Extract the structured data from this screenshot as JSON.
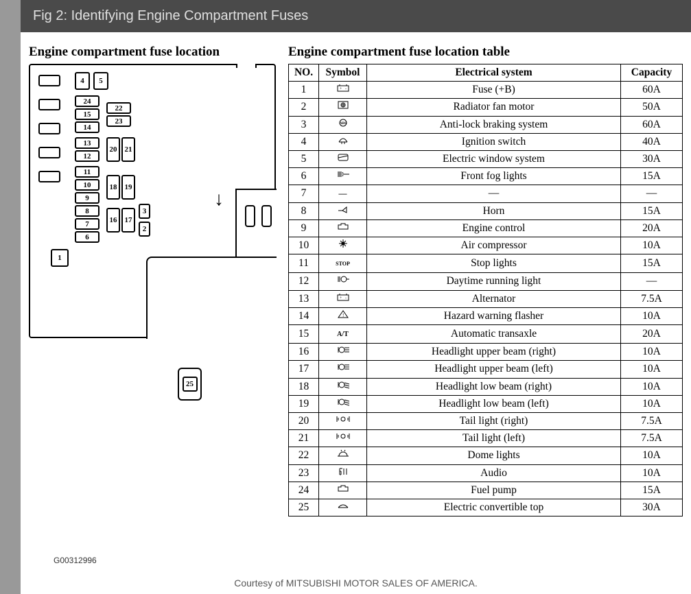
{
  "title": "Fig 2: Identifying Engine Compartment Fuses",
  "left_heading": "Engine compartment fuse location",
  "right_heading": "Engine compartment fuse location table",
  "code": "G00312996",
  "courtesy": "Courtesy of MITSUBISHI MOTOR SALES OF AMERICA.",
  "extra_label": "25",
  "diagram_labels": {
    "b4": "4",
    "b5": "5",
    "b24": "24",
    "b22": "22",
    "b23": "23",
    "b15": "15",
    "b14": "14",
    "b13": "13",
    "b12": "12",
    "b11": "11",
    "b20": "20",
    "b21": "21",
    "b10": "10",
    "b9": "9",
    "b8": "8",
    "b7": "7",
    "b6": "6",
    "b18": "18",
    "b19": "19",
    "b16": "16",
    "b17": "17",
    "b3": "3",
    "b2": "2",
    "b1": "1"
  },
  "table": {
    "headers": {
      "no": "NO.",
      "symbol": "Symbol",
      "system": "Electrical system",
      "capacity": "Capacity"
    },
    "rows": [
      {
        "no": "1",
        "sym": "bat",
        "system": "Fuse (+B)",
        "cap": "60A"
      },
      {
        "no": "2",
        "sym": "fan",
        "system": "Radiator fan motor",
        "cap": "50A"
      },
      {
        "no": "3",
        "sym": "abs",
        "system": "Anti-lock braking system",
        "cap": "60A"
      },
      {
        "no": "4",
        "sym": "ign",
        "system": "Ignition switch",
        "cap": "40A"
      },
      {
        "no": "5",
        "sym": "win",
        "system": "Electric window system",
        "cap": "30A"
      },
      {
        "no": "6",
        "sym": "fog",
        "system": "Front fog lights",
        "cap": "15A"
      },
      {
        "no": "7",
        "sym": "dash",
        "system": "—",
        "cap": "—"
      },
      {
        "no": "8",
        "sym": "horn",
        "system": "Horn",
        "cap": "15A"
      },
      {
        "no": "9",
        "sym": "eng",
        "system": "Engine control",
        "cap": "20A"
      },
      {
        "no": "10",
        "sym": "ac",
        "system": "Air compressor",
        "cap": "10A"
      },
      {
        "no": "11",
        "sym": "stop",
        "system": "Stop lights",
        "cap": "15A"
      },
      {
        "no": "12",
        "sym": "drl",
        "system": "Daytime running light",
        "cap": "—"
      },
      {
        "no": "13",
        "sym": "bat",
        "system": "Alternator",
        "cap": "7.5A"
      },
      {
        "no": "14",
        "sym": "haz",
        "system": "Hazard warning flasher",
        "cap": "10A"
      },
      {
        "no": "15",
        "sym": "at",
        "system": "Automatic transaxle",
        "cap": "20A"
      },
      {
        "no": "16",
        "sym": "beam",
        "system": "Headlight upper beam (right)",
        "cap": "10A"
      },
      {
        "no": "17",
        "sym": "beam",
        "system": "Headlight upper beam (left)",
        "cap": "10A"
      },
      {
        "no": "18",
        "sym": "lbeam",
        "system": "Headlight low beam (right)",
        "cap": "10A"
      },
      {
        "no": "19",
        "sym": "lbeam",
        "system": "Headlight low beam (left)",
        "cap": "10A"
      },
      {
        "no": "20",
        "sym": "tail",
        "system": "Tail light (right)",
        "cap": "7.5A"
      },
      {
        "no": "21",
        "sym": "tail",
        "system": "Tail light (left)",
        "cap": "7.5A"
      },
      {
        "no": "22",
        "sym": "dome",
        "system": "Dome lights",
        "cap": "10A"
      },
      {
        "no": "23",
        "sym": "audio",
        "system": "Audio",
        "cap": "10A"
      },
      {
        "no": "24",
        "sym": "eng",
        "system": "Fuel pump",
        "cap": "15A"
      },
      {
        "no": "25",
        "sym": "conv",
        "system": "Electric convertible top",
        "cap": "30A"
      }
    ]
  }
}
